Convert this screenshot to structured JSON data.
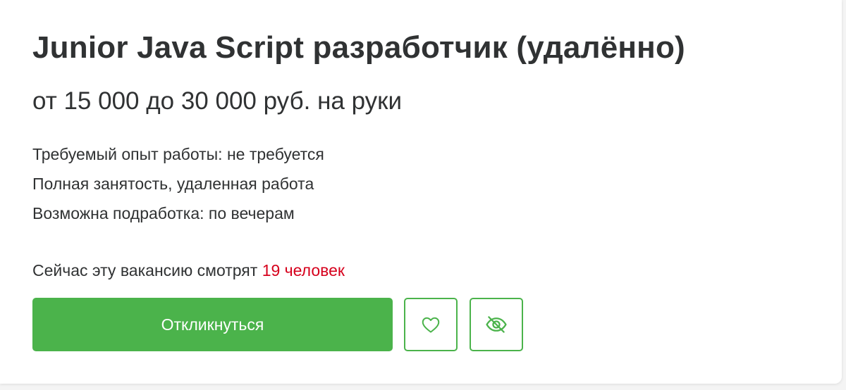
{
  "vacancy": {
    "title": "Junior Java Script разработчик (удалённо)",
    "salary": "от 15 000 до 30 000 руб. на руки",
    "details": [
      "Требуемый опыт работы: не требуется",
      "Полная занятость, удаленная работа",
      "Возможна подработка: по вечерам"
    ],
    "viewers_prefix": "Сейчас эту вакансию смотрят ",
    "viewers_count": "19 человек"
  },
  "actions": {
    "respond_label": "Откликнуться",
    "favorite_icon": "heart-icon",
    "hide_icon": "eye-off-icon"
  },
  "colors": {
    "accent": "#4bb34b",
    "viewers_count": "#d6001c",
    "text": "#303233"
  }
}
